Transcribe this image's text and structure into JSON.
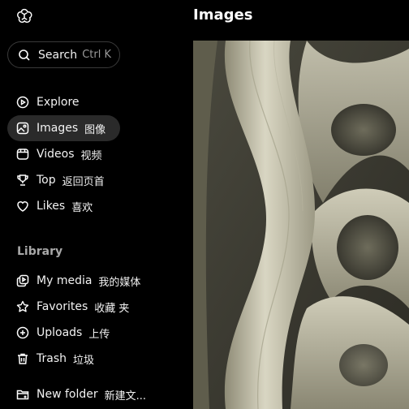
{
  "header": {
    "title": "Images"
  },
  "search": {
    "label": "Search",
    "shortcut": "Ctrl K"
  },
  "nav": [
    {
      "label": "Explore",
      "cjk": "",
      "icon": "play-circle-icon"
    },
    {
      "label": "Images",
      "cjk": "图像",
      "icon": "image-icon",
      "active": true
    },
    {
      "label": "Videos",
      "cjk": "视频",
      "icon": "video-icon"
    },
    {
      "label": "Top",
      "cjk": "返回页首",
      "icon": "trophy-icon"
    },
    {
      "label": "Likes",
      "cjk": "喜欢",
      "icon": "heart-icon"
    }
  ],
  "library": {
    "title": "Library",
    "items": [
      {
        "label": "My media",
        "cjk": "我的媒体",
        "icon": "media-icon"
      },
      {
        "label": "Favorites",
        "cjk": "收藏 夹",
        "icon": "star-icon"
      },
      {
        "label": "Uploads",
        "cjk": "上传",
        "icon": "plus-circle-icon"
      },
      {
        "label": "Trash",
        "cjk": "垃圾",
        "icon": "trash-icon"
      },
      {
        "label": "New folder",
        "cjk": "新建文...",
        "icon": "folder-plus-icon"
      }
    ]
  },
  "colors": {
    "background": "#000000",
    "active_item": "#2a2a2a",
    "muted_text": "#a8a8a8"
  }
}
